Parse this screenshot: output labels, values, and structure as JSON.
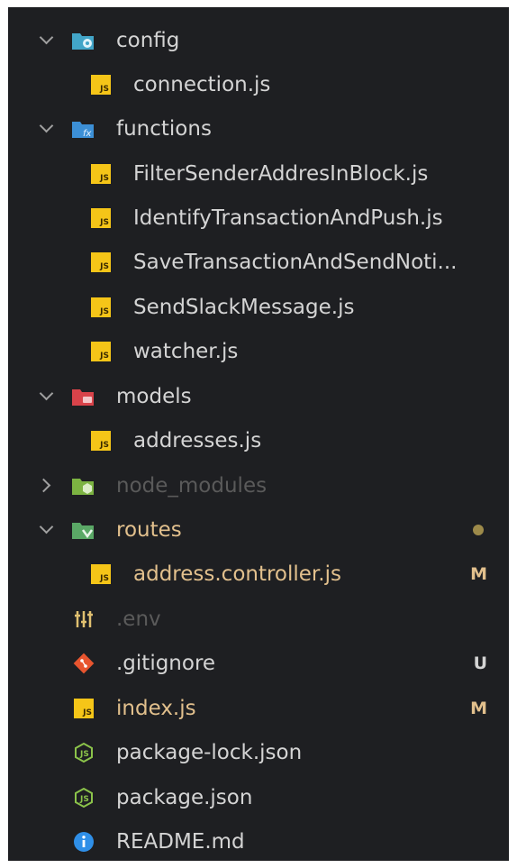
{
  "tree": {
    "items": [
      {
        "kind": "folder",
        "label": "config",
        "expanded": true,
        "icon": "folder-config-icon",
        "color": "#d4d4d4"
      },
      {
        "kind": "file",
        "label": "connection.js",
        "icon": "js-file-icon",
        "color": "#d4d4d4"
      },
      {
        "kind": "folder",
        "label": "functions",
        "expanded": true,
        "icon": "folder-functions-icon",
        "color": "#d4d4d4"
      },
      {
        "kind": "file",
        "label": "FilterSenderAddresInBlock.js",
        "icon": "js-file-icon",
        "color": "#d4d4d4"
      },
      {
        "kind": "file",
        "label": "IdentifyTransactionAndPush.js",
        "icon": "js-file-icon",
        "color": "#d4d4d4"
      },
      {
        "kind": "file",
        "label": "SaveTransactionAndSendNoti...",
        "icon": "js-file-icon",
        "color": "#d4d4d4"
      },
      {
        "kind": "file",
        "label": "SendSlackMessage.js",
        "icon": "js-file-icon",
        "color": "#d4d4d4"
      },
      {
        "kind": "file",
        "label": "watcher.js",
        "icon": "js-file-icon",
        "color": "#d4d4d4"
      },
      {
        "kind": "folder",
        "label": "models",
        "expanded": true,
        "icon": "folder-models-icon",
        "color": "#d4d4d4"
      },
      {
        "kind": "file",
        "label": "addresses.js",
        "icon": "js-file-icon",
        "color": "#d4d4d4"
      },
      {
        "kind": "folder",
        "label": "node_modules",
        "expanded": false,
        "icon": "folder-node-icon",
        "color": "#5a5a5a"
      },
      {
        "kind": "folder",
        "label": "routes",
        "expanded": true,
        "icon": "folder-routes-icon",
        "color": "#e2c08d",
        "status_dot": "#9d8a4a"
      },
      {
        "kind": "file",
        "label": "address.controller.js",
        "icon": "js-file-icon",
        "color": "#e2c08d",
        "badge": "M",
        "badge_color": "#e2c08d"
      },
      {
        "kind": "root-file",
        "label": ".env",
        "icon": "env-settings-icon",
        "color": "#5a5a5a"
      },
      {
        "kind": "root-file",
        "label": ".gitignore",
        "icon": "git-icon",
        "color": "#d4d4d4",
        "badge": "U",
        "badge_color": "#d4d4d4"
      },
      {
        "kind": "root-file",
        "label": "index.js",
        "icon": "js-file-icon",
        "color": "#e2c08d",
        "badge": "M",
        "badge_color": "#e2c08d"
      },
      {
        "kind": "root-file",
        "label": "package-lock.json",
        "icon": "nodejs-icon",
        "color": "#d4d4d4"
      },
      {
        "kind": "root-file",
        "label": "package.json",
        "icon": "nodejs-icon",
        "color": "#d4d4d4"
      },
      {
        "kind": "root-file",
        "label": "README.md",
        "icon": "info-icon",
        "color": "#d4d4d4"
      }
    ],
    "js_glyph": "JS"
  },
  "colors": {
    "panel": "#1e1f22",
    "js_yellow": "#f5c518",
    "modified": "#e2c08d",
    "dimmed": "#5a5a5a"
  }
}
